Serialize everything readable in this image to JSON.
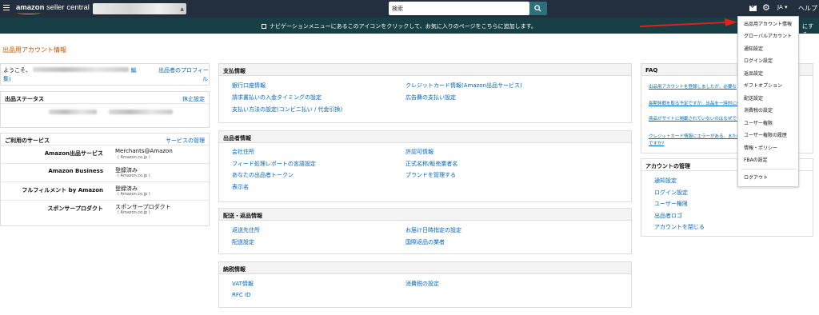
{
  "topbar": {
    "logo_bold": "amazon",
    "logo_rest": " seller central",
    "search_placeholder": "検索",
    "lang": "JA",
    "help": "ヘルプ",
    "icons": [
      "menu-icon",
      "search-icon",
      "mail-icon",
      "gear-icon"
    ]
  },
  "navbar": {
    "message": "ナビゲーションメニューにあるこのアイコンをクリックして、お気に入りのページをこちらに追加します。",
    "add_label": "にする"
  },
  "page_title": "出品用アカウント情報",
  "welcome": {
    "greeting": "ようこそ、",
    "edit_tail": "編",
    "edit_tail2": "集)",
    "profile_link": "出品者のプロフィー",
    "profile_link2": "ル"
  },
  "status": {
    "title": "出品ステータス",
    "action": "休止設定"
  },
  "services": {
    "title": "ご利用のサービス",
    "action": "サービスの管理",
    "rows": [
      {
        "name": "Amazon出品サービス",
        "value": "Merchants@Amazon",
        "sub": "( Amazon.co.jp )"
      },
      {
        "name": "Amazon Business",
        "value": "登録済み",
        "sub": "( Amazon.co.jp )"
      },
      {
        "name": "フルフィルメント by Amazon",
        "value": "登録済み",
        "sub": "( Amazon.co.jp )"
      },
      {
        "name": "スポンサープロダクト",
        "value": "スポンサープロダクト",
        "sub": "( Amazon.co.jp )"
      }
    ]
  },
  "payment": {
    "title": "支払情報",
    "left": [
      "銀行口座情報",
      "請求書払いの入金タイミングの設定",
      "支払い方法の設定(コンビニ払い / 代金引換)"
    ],
    "right": [
      "クレジットカード情報(Amazon出品サービス)",
      "広告費の支払い設定"
    ]
  },
  "seller": {
    "title": "出品者情報",
    "left": [
      "会社住所",
      "フィード処理レポートの言語設定",
      "あなたの出品者トークン",
      "表示名"
    ],
    "right": [
      "許認可情報",
      "正式名称/販売業者名",
      "ブランドを管理する"
    ]
  },
  "shipping": {
    "title": "配送・返品情報",
    "left": [
      "返送先住所",
      "配送設定"
    ],
    "right": [
      "お届け日時指定の設定",
      "国際返品の業者"
    ]
  },
  "tax": {
    "title": "納税情報",
    "left": [
      "VAT情報",
      "RFC ID"
    ],
    "right": [
      "消費税の設定"
    ]
  },
  "faq": {
    "title": "FAQ",
    "items": [
      "出品用アカウントを登録しましたが、必要な",
      "長期休暇を取る予定ですが、出品を一時的に停",
      "商品がサイトに掲載されていないのはなぜです",
      "クレジットカード情報にエラーがある。または"
    ],
    "tail": "ですか?"
  },
  "account_mgmt": {
    "title": "アカウントの管理",
    "items": [
      "通知設定",
      "ログイン設定",
      "ユーザー権限",
      "出品者ロゴ",
      "アカウントを閉じる"
    ]
  },
  "dropdown": {
    "items": [
      "出品用アカウント情報",
      "グローバルアカウント",
      "通知設定",
      "ログイン設定",
      "返品設定",
      "ギフトオプション",
      "配送設定",
      "消費税の設定",
      "ユーザー権限",
      "ユーザー権限の履歴",
      "情報・ポリシー",
      "FBAの設定"
    ],
    "last": "ログアウト"
  },
  "colors": {
    "topbar": "#232f3e",
    "navbar": "#173f45",
    "link": "#0066c0",
    "title": "#c45500",
    "arrow": "#e0201a"
  }
}
